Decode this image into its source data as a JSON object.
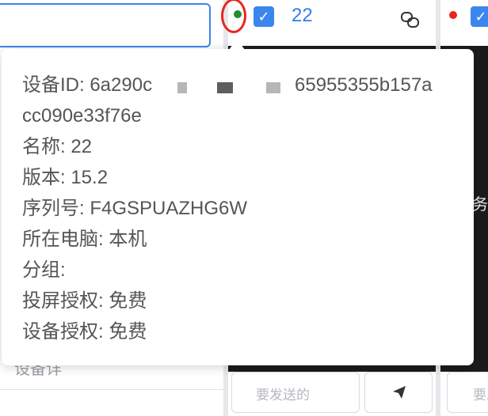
{
  "tooltip": {
    "device_id_label": "设备ID: 6a290c",
    "device_id_rest": "65955355b157a",
    "device_id_cont": "cc090e33f76e",
    "name": "名称: 22",
    "version": "版本: 15.2",
    "serial": "序列号: F4GSPUAZHG6W",
    "computer": "所在电脑: 本机",
    "group": "分组:",
    "cast_license": "投屏授权: 免费",
    "device_license": "设备授权: 免费"
  },
  "device_card": {
    "name": "22",
    "status_color": "#1f8f2e",
    "checked": true,
    "message_placeholder": "要发送的",
    "send_icon": "paper-plane-icon"
  },
  "device_card_2": {
    "status_color": "#e8261c",
    "side_text": "务",
    "message_placeholder": "要发"
  },
  "left_panel": {
    "partial_text": "设备详"
  },
  "colors": {
    "accent": "#3b86ee",
    "online": "#1f8f2e",
    "offline": "#e8261c"
  }
}
